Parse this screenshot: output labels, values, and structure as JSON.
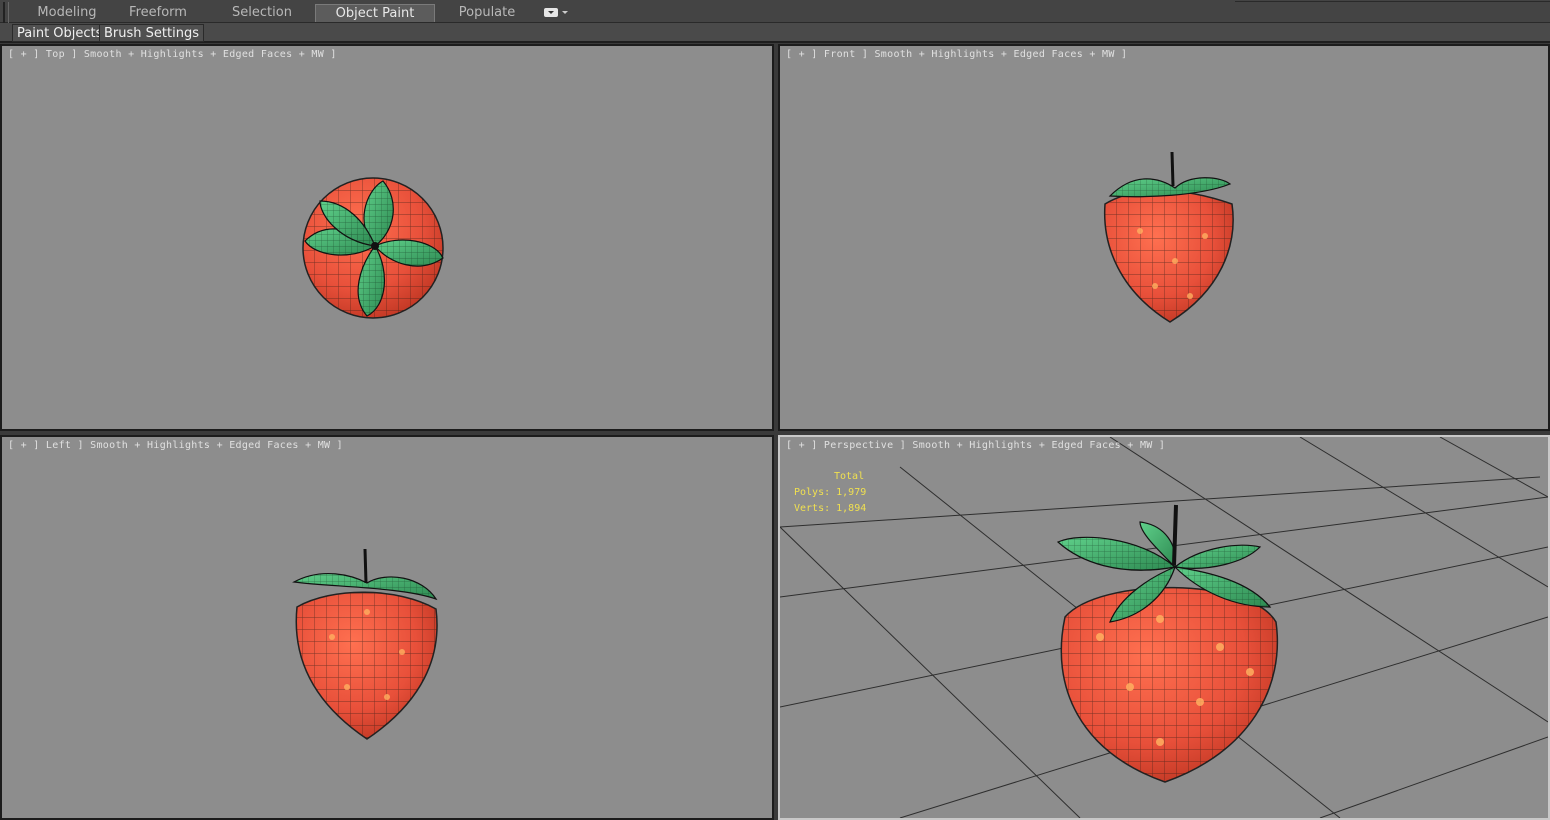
{
  "ribbon": {
    "tabs": [
      {
        "label": "Modeling"
      },
      {
        "label": "Freeform"
      },
      {
        "label": "Selection"
      },
      {
        "label": "Object Paint",
        "active": true
      },
      {
        "label": "Populate"
      }
    ],
    "dropdown_icon": "ribbon-options-icon"
  },
  "panel": {
    "buttons": [
      {
        "label": "Paint Objects"
      },
      {
        "label": "Brush Settings"
      }
    ]
  },
  "viewports": {
    "top": {
      "label": "[ + ] Top ] Smooth + Highlights + Edged Faces + MW ]"
    },
    "front": {
      "label": "[ + ] Front ] Smooth + Highlights + Edged Faces + MW ]"
    },
    "left": {
      "label": "[ + ] Left ] Smooth + Highlights + Edged Faces + MW ]"
    },
    "perspective": {
      "label": "[ + ] Perspective ] Smooth + Highlights + Edged Faces + MW ]",
      "stats": {
        "title": "Total",
        "polys": "Polys: 1,979",
        "verts": "Verts: 1,894"
      }
    }
  },
  "colors": {
    "viewport_bg": "#8d8d8d",
    "strawberry": "#e8503a",
    "leaf": "#3fae6a",
    "stats_text": "#f0e050"
  }
}
